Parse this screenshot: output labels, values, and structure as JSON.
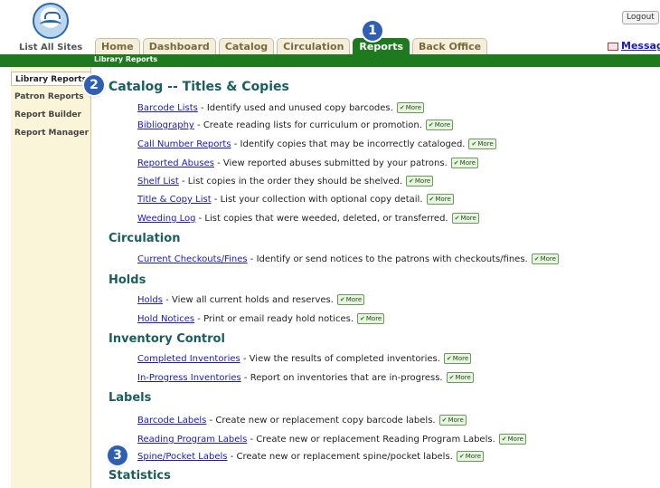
{
  "header": {
    "list_all": "List All Sites",
    "logout": "Logout",
    "message": "Message",
    "tabs": [
      "Home",
      "Dashboard",
      "Catalog",
      "Circulation",
      "Reports",
      "Back Office"
    ],
    "active_tab": "Reports",
    "subtitle": "Library Reports"
  },
  "badges": [
    "1",
    "2",
    "3"
  ],
  "sidebar": {
    "items": [
      "Library Reports",
      "Patron Reports",
      "Report Builder",
      "Report Manager"
    ]
  },
  "more_label": "More",
  "sections": [
    {
      "title": "Catalog -- Titles & Copies",
      "items": [
        {
          "link": "Barcode Lists",
          "desc": " - Identify used and unused copy barcodes."
        },
        {
          "link": "Bibliography",
          "desc": " - Create reading lists for curriculum or promotion."
        },
        {
          "link": "Call Number Reports",
          "desc": " - Identify copies that may be incorrectly cataloged."
        },
        {
          "link": "Reported Abuses",
          "desc": " - View reported abuses submitted by your patrons."
        },
        {
          "link": "Shelf List",
          "desc": " - List copies in the order they should be shelved."
        },
        {
          "link": "Title & Copy List",
          "desc": " - List your collection with optional copy detail."
        },
        {
          "link": "Weeding Log",
          "desc": " - List copies that were weeded, deleted, or transferred."
        }
      ]
    },
    {
      "title": "Circulation",
      "items": [
        {
          "link": "Current Checkouts/Fines",
          "desc": " - Identify or send notices to the patrons with checkouts/fines."
        }
      ]
    },
    {
      "title": "Holds",
      "items": [
        {
          "link": "Holds",
          "desc": " - View all current holds and reserves."
        },
        {
          "link": "Hold Notices",
          "desc": " - Print or email ready hold notices."
        }
      ]
    },
    {
      "title": "Inventory Control",
      "items": [
        {
          "link": "Completed Inventories",
          "desc": " - View the results of completed inventories."
        },
        {
          "link": "In-Progress Inventories",
          "desc": " - Report on inventories that are in-progress."
        }
      ]
    },
    {
      "title": "Labels",
      "items": [
        {
          "link": "Barcode Labels",
          "desc": " - Create new or replacement copy barcode labels."
        },
        {
          "link": "Reading Program Labels",
          "desc": " - Create new or replacement Reading Program Labels."
        },
        {
          "link": "Spine/Pocket Labels",
          "desc": " - Create new or replacement spine/pocket labels."
        }
      ]
    },
    {
      "title": "Statistics",
      "items": []
    }
  ]
}
